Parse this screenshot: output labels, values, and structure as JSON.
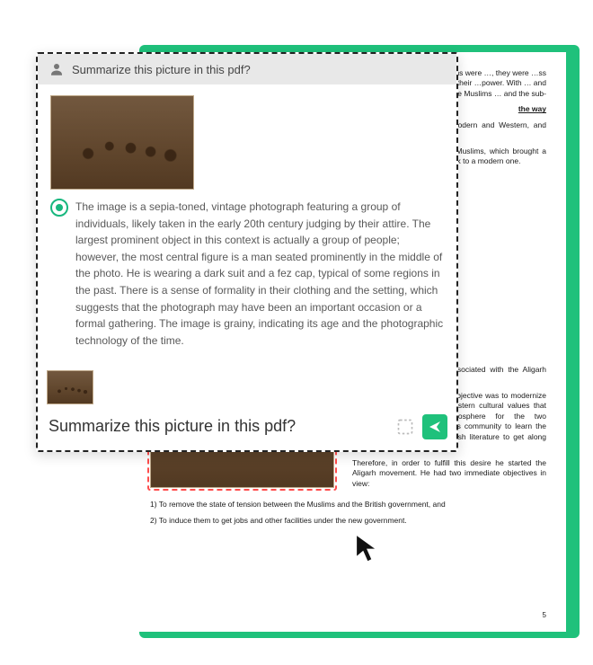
{
  "chat": {
    "user_prompt": "Summarize this picture in this pdf?",
    "ai_response": "The image is a sepia-toned, vintage photograph featuring a group of individuals, likely taken in the early 20th century judging by their attire. The largest prominent object in this context is actually a group of people; however, the most central figure is a man seated prominently in the middle of the photo. He is wearing a dark suit and a fez cap, typical of some regions in the past. There is a sense of formality in their clothing and the setting, which suggests that the photograph may have been an important occasion or a formal gathering. The image is grainy, indicating its age and the photographic technology of the time.",
    "input_value": "Summarize this picture in this pdf?"
  },
  "document": {
    "para_top_right": "…aster for the Muslims were …, they were …ss revenge. …ms as their …power. With … and every …e Muslims … and the sub-",
    "section_title": "the way",
    "body_text_1": "…nted a new …cted Arabic, … as the only …55. A wrong attitude of everything modern and Western, and disinclination to make …was created …would have",
    "body_text_2": "…ared on the …vation of the …phase of its …osperity for regeneration of the Indian Muslims, which brought a complete orientation in their lives. He tried to transform Muslim minds from medieval outlook to a modern one.",
    "col_left_caption": "",
    "col_right_p1": "Hali and Shibli were also associated with the Aligarh Movement.",
    "col_right_p2": "Sir Syed's first and foremost objective was to modernize the Muslims following the Western cultural values that could create friendly atmosphere for the two communities. He motivated his community to learn the Western philosophy and English literature to get along with the ruling people.",
    "col_right_p3": "Therefore, in order to fulfill this desire he started the Aligarh movement. He had two immediate objectives in view:",
    "list_1": "1) To remove the state of tension between the Muslims and the British government, and",
    "list_2": "2) To induce them to get jobs and other facilities under the new government.",
    "page_number": "5"
  }
}
